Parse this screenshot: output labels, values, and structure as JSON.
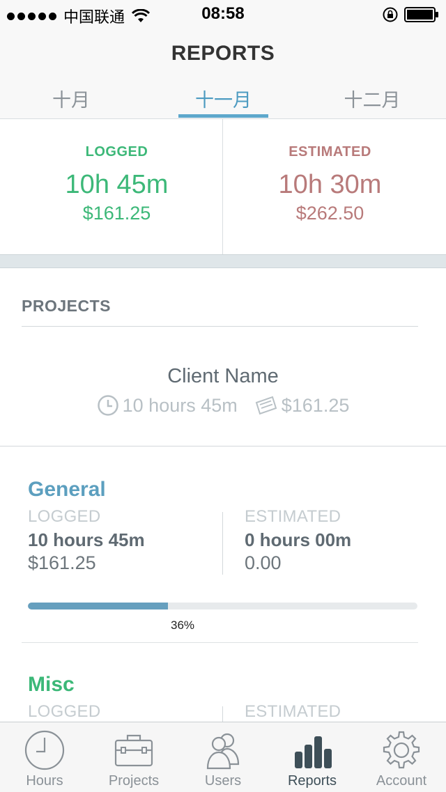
{
  "status_bar": {
    "carrier": "中国联通",
    "time": "08:58"
  },
  "header": {
    "title": "REPORTS",
    "tabs": [
      {
        "label": "十月",
        "active": false
      },
      {
        "label": "十一月",
        "active": true
      },
      {
        "label": "十二月",
        "active": false
      }
    ]
  },
  "summary": {
    "logged": {
      "label": "LOGGED",
      "time": "10h 45m",
      "amount": "$161.25"
    },
    "estimated": {
      "label": "ESTIMATED",
      "time": "10h 30m",
      "amount": "$262.50"
    }
  },
  "projects_section": {
    "title": "PROJECTS",
    "client": {
      "name": "Client Name",
      "hours": "10 hours 45m",
      "amount": "$161.25"
    },
    "projects": [
      {
        "name": "General",
        "logged_label": "LOGGED",
        "logged_hours": "10 hours 45m",
        "logged_amount": "$161.25",
        "estimated_label": "ESTIMATED",
        "estimated_hours": "0 hours 00m",
        "estimated_amount": "0.00",
        "progress_percent": 36,
        "progress_label": "36%"
      },
      {
        "name": "Misc",
        "logged_label": "LOGGED",
        "estimated_label": "ESTIMATED"
      }
    ]
  },
  "tab_bar": {
    "items": [
      {
        "label": "Hours",
        "icon": "clock-icon"
      },
      {
        "label": "Projects",
        "icon": "briefcase-icon"
      },
      {
        "label": "Users",
        "icon": "users-icon"
      },
      {
        "label": "Reports",
        "icon": "bar-chart-icon",
        "active": true
      },
      {
        "label": "Account",
        "icon": "gear-icon"
      }
    ]
  },
  "colors": {
    "logged": "#3cb878",
    "estimated": "#b87a7a",
    "accent": "#5ea8cc",
    "progress": "#669fbe"
  }
}
